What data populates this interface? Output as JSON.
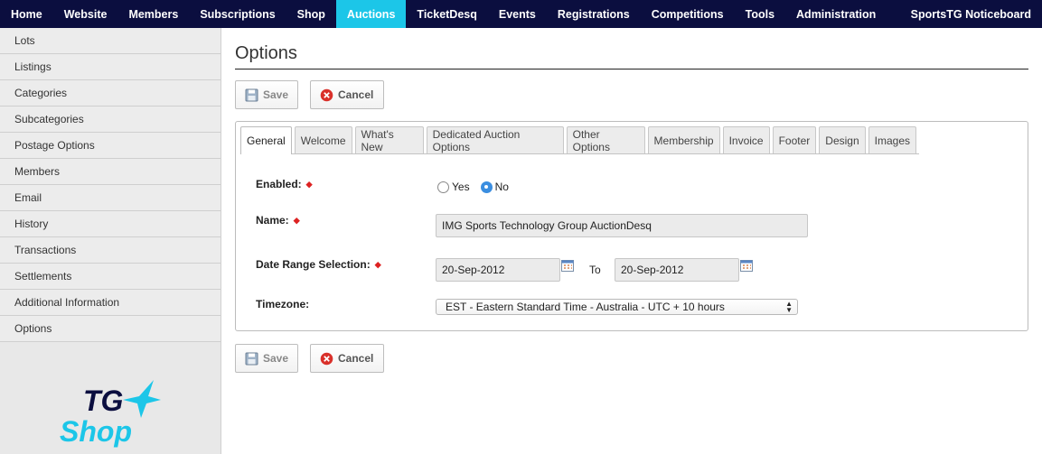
{
  "nav": {
    "items": [
      {
        "label": "Home",
        "active": false
      },
      {
        "label": "Website",
        "active": false
      },
      {
        "label": "Members",
        "active": false
      },
      {
        "label": "Subscriptions",
        "active": false
      },
      {
        "label": "Shop",
        "active": false
      },
      {
        "label": "Auctions",
        "active": true
      },
      {
        "label": "TicketDesq",
        "active": false
      },
      {
        "label": "Events",
        "active": false
      },
      {
        "label": "Registrations",
        "active": false
      },
      {
        "label": "Competitions",
        "active": false
      },
      {
        "label": "Tools",
        "active": false
      },
      {
        "label": "Administration",
        "active": false
      }
    ],
    "right_label": "SportsTG Noticeboard",
    "bg_color": "#0b0e3f",
    "active_color": "#1cc6e8"
  },
  "sidebar": {
    "items": [
      "Lots",
      "Listings",
      "Categories",
      "Subcategories",
      "Postage Options",
      "Members",
      "Email",
      "History",
      "Transactions",
      "Settlements",
      "Additional Information",
      "Options"
    ],
    "logo_line1": "TG",
    "logo_line2": "Shop"
  },
  "main": {
    "title": "Options",
    "save_label": "Save",
    "cancel_label": "Cancel",
    "tabs": [
      {
        "label": "General",
        "active": true
      },
      {
        "label": "Welcome",
        "active": false
      },
      {
        "label": "What's New",
        "active": false
      },
      {
        "label": "Dedicated Auction Options",
        "active": false
      },
      {
        "label": "Other Options",
        "active": false
      },
      {
        "label": "Membership",
        "active": false
      },
      {
        "label": "Invoice",
        "active": false
      },
      {
        "label": "Footer",
        "active": false
      },
      {
        "label": "Design",
        "active": false
      },
      {
        "label": "Images",
        "active": false
      }
    ],
    "form": {
      "enabled_label": "Enabled:",
      "enabled_options": [
        "Yes",
        "No"
      ],
      "enabled_value": "No",
      "name_label": "Name:",
      "name_value": "IMG Sports Technology Group AuctionDesq",
      "date_label": "Date Range Selection:",
      "date_from": "20-Sep-2012",
      "date_to_label": "To",
      "date_to": "20-Sep-2012",
      "timezone_label": "Timezone:",
      "timezone_value": "EST - Eastern Standard Time - Australia - UTC + 10 hours"
    }
  }
}
